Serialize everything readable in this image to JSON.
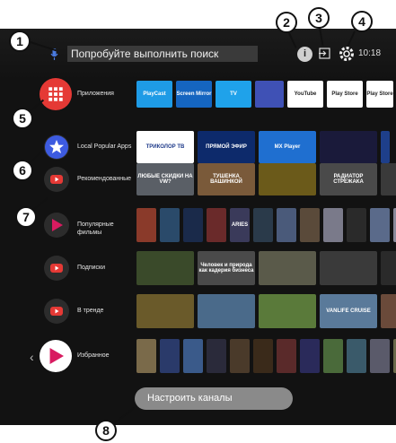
{
  "search": {
    "text": "Попробуйте выполнить поиск"
  },
  "topbar": {
    "info_letter": "i",
    "time": "10:18"
  },
  "callouts": [
    "1",
    "2",
    "3",
    "4",
    "5",
    "6",
    "7",
    "8"
  ],
  "rows": [
    {
      "label": "Приложения",
      "icon": "apps-grid-icon",
      "tiles": [
        {
          "text": "PlayCast",
          "color": "#1e9be6",
          "w": 40
        },
        {
          "text": "Screen Mirror",
          "color": "#1565c0",
          "w": 40
        },
        {
          "text": "TV",
          "color": "#1fa2ea",
          "w": 40
        },
        {
          "text": "",
          "color": "#3f51b5",
          "w": 32
        },
        {
          "text": "YouTube",
          "color": "#ffffff",
          "fg": "#222",
          "w": 40
        },
        {
          "text": "Play Store",
          "color": "#ffffff",
          "fg": "#222",
          "w": 40
        },
        {
          "text": "Play Store",
          "color": "#ffffff",
          "fg": "#222",
          "w": 30
        }
      ]
    },
    {
      "label": "Local Popular Apps",
      "icon": "star-icon",
      "tiles": [
        {
          "text": "ТРИКОЛОР ТВ",
          "color": "#ffffff",
          "fg": "#1e3a8a",
          "w": 64
        },
        {
          "text": "ПРЯМОЙ ЭФИР",
          "color": "#0d2a6b",
          "w": 64
        },
        {
          "text": "MX Player",
          "color": "#1f6fd0",
          "w": 64
        },
        {
          "text": "",
          "color": "#1a1a3a",
          "w": 64
        },
        {
          "text": "",
          "color": "#1e3f8a",
          "w": 10
        }
      ]
    },
    {
      "label": "Рекомендованные",
      "icon": "youtube-icon",
      "tiles": [
        {
          "text": "ЛЮБЫЕ СКИДКИ НА VW?",
          "color": "#5a5f66",
          "w": 64
        },
        {
          "text": "ТУШЕНКА ВАШИНКОЙ",
          "color": "#7a5a3a",
          "w": 64
        },
        {
          "text": "",
          "color": "#6b5a1a",
          "w": 64
        },
        {
          "text": "РАДИАТОР СТРЕЖАКА",
          "color": "#4a4a4a",
          "w": 64
        },
        {
          "text": "",
          "color": "#3a3a3a",
          "w": 20
        }
      ]
    },
    {
      "label": "Популярные фильмы",
      "icon": "play-movies-icon",
      "tiles": [
        {
          "text": "",
          "color": "#8a3a2a",
          "w": 22
        },
        {
          "text": "",
          "color": "#2a4a6a",
          "w": 22
        },
        {
          "text": "",
          "color": "#1a2a4a",
          "w": 22
        },
        {
          "text": "",
          "color": "#6a2a2a",
          "w": 22
        },
        {
          "text": "ARIES",
          "color": "#3a3a5a",
          "w": 22
        },
        {
          "text": "",
          "color": "#2a3a4a",
          "w": 22
        },
        {
          "text": "",
          "color": "#4a5a7a",
          "w": 22
        },
        {
          "text": "",
          "color": "#5a4a3a",
          "w": 22
        },
        {
          "text": "",
          "color": "#7a7a8a",
          "w": 22
        },
        {
          "text": "",
          "color": "#2a2a2a",
          "w": 22
        },
        {
          "text": "",
          "color": "#5a6a8a",
          "w": 22
        },
        {
          "text": "",
          "color": "#8a8a9a",
          "w": 22
        },
        {
          "text": "",
          "color": "#3a4a5a",
          "w": 22
        }
      ]
    },
    {
      "label": "Подписки",
      "icon": "youtube-icon",
      "tiles": [
        {
          "text": "",
          "color": "#3a4a2a",
          "w": 64
        },
        {
          "text": "Человек и природа как кадерия бизнеса",
          "color": "#4a4a4a",
          "w": 64
        },
        {
          "text": "",
          "color": "#5a5a4a",
          "w": 64
        },
        {
          "text": "",
          "color": "#3a3a3a",
          "w": 64
        },
        {
          "text": "",
          "color": "#2a2a2a",
          "w": 20
        }
      ]
    },
    {
      "label": "В тренде",
      "icon": "youtube-icon",
      "tiles": [
        {
          "text": "",
          "color": "#6a5a2a",
          "w": 64
        },
        {
          "text": "",
          "color": "#4a6a8a",
          "w": 64
        },
        {
          "text": "",
          "color": "#5a7a3a",
          "w": 64
        },
        {
          "text": "VANLIFE CRUISE",
          "color": "#5a7a9a",
          "w": 64
        },
        {
          "text": "",
          "color": "#6a4a3a",
          "w": 20
        }
      ]
    },
    {
      "label": "Избранное",
      "icon": "play-movies-icon",
      "tiles": [
        {
          "text": "",
          "color": "#7a6a4a",
          "w": 22
        },
        {
          "text": "",
          "color": "#2a3a6a",
          "w": 22
        },
        {
          "text": "",
          "color": "#3a5a8a",
          "w": 22
        },
        {
          "text": "",
          "color": "#2a2a3a",
          "w": 22
        },
        {
          "text": "",
          "color": "#4a3a2a",
          "w": 22
        },
        {
          "text": "",
          "color": "#3a2a1a",
          "w": 22
        },
        {
          "text": "",
          "color": "#5a2a2a",
          "w": 22
        },
        {
          "text": "",
          "color": "#2a2a5a",
          "w": 22
        },
        {
          "text": "",
          "color": "#4a6a3a",
          "w": 22
        },
        {
          "text": "",
          "color": "#3a5a6a",
          "w": 22
        },
        {
          "text": "",
          "color": "#5a5a6a",
          "w": 22
        },
        {
          "text": "",
          "color": "#6a6a4a",
          "w": 22
        },
        {
          "text": "",
          "color": "#2a4a5a",
          "w": 22
        }
      ]
    }
  ],
  "customize": {
    "label": "Настроить каналы"
  }
}
